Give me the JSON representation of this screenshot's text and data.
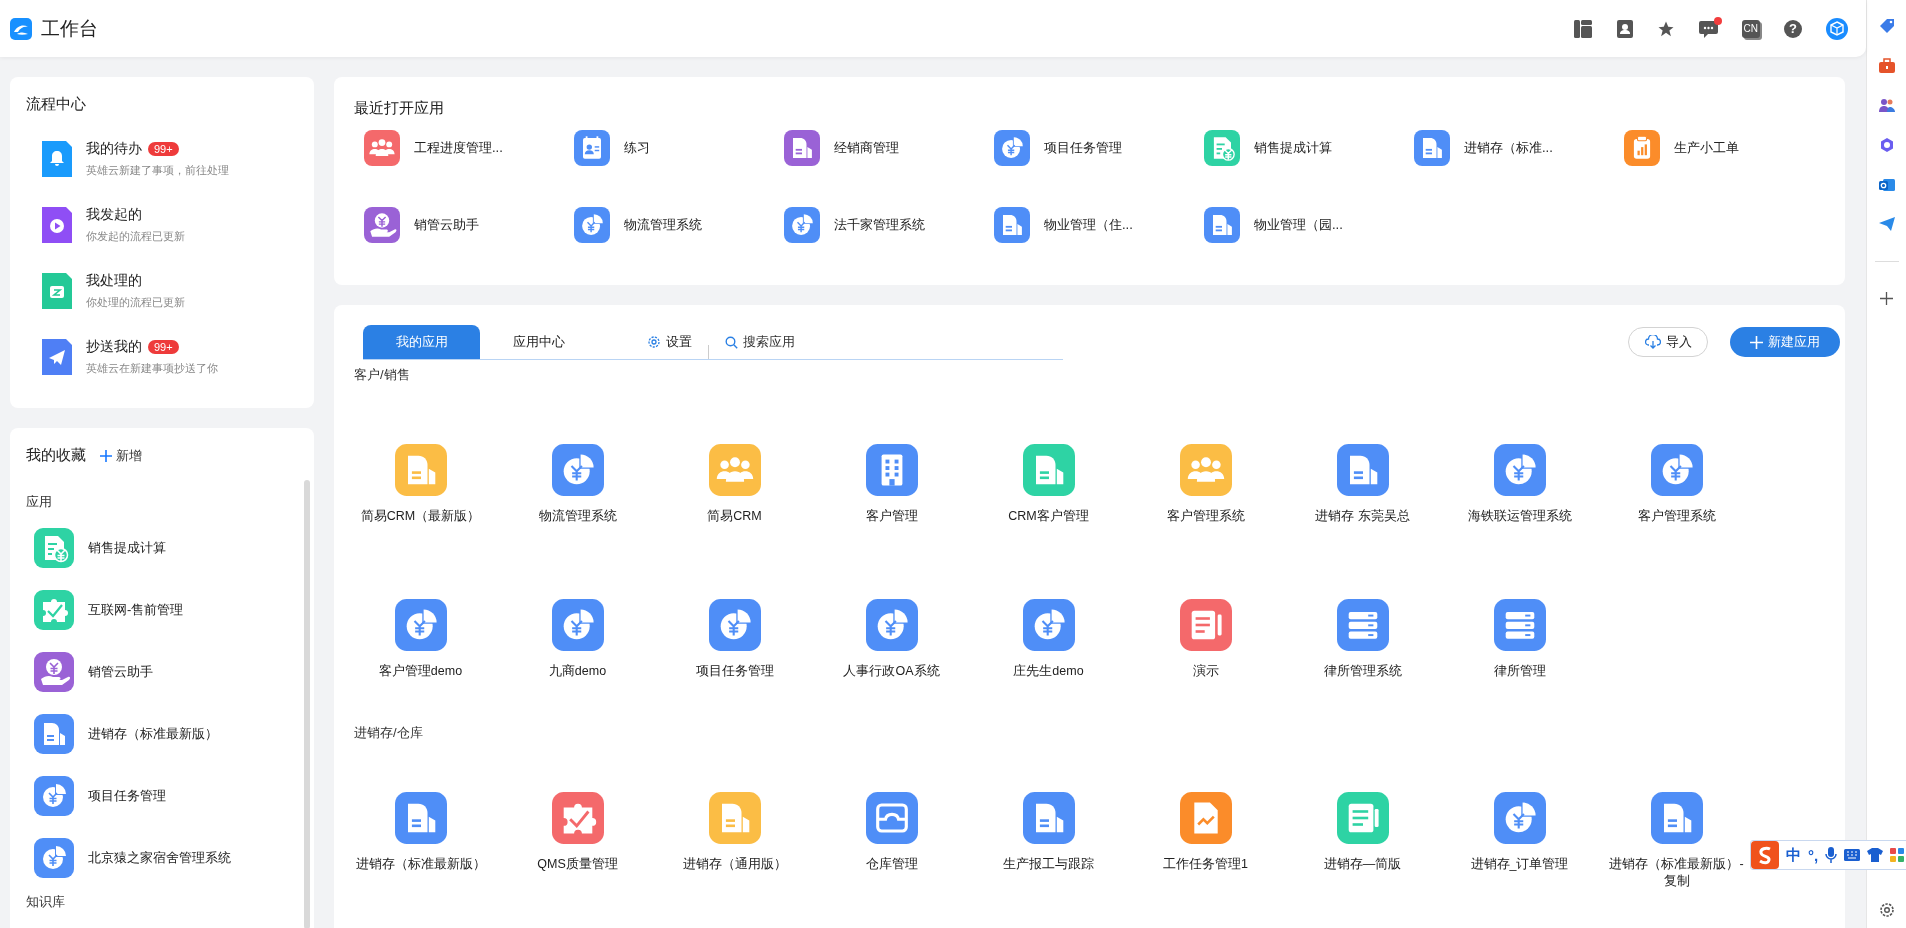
{
  "header": {
    "title": "工作台",
    "lang": "CN",
    "help": "?",
    "unread": true
  },
  "flow_center": {
    "title": "流程中心",
    "items": [
      {
        "kind": "bell",
        "color": "#1a9bfc",
        "title": "我的待办",
        "badge": "99+",
        "subtitle": "英雄云新建了事项，前往处理"
      },
      {
        "kind": "play",
        "color": "#8f4ef5",
        "title": "我发起的",
        "subtitle": "你发起的流程已更新"
      },
      {
        "kind": "box",
        "color": "#24c997",
        "title": "我处理的",
        "subtitle": "你处理的流程已更新"
      },
      {
        "kind": "plane",
        "color": "#4f7ff5",
        "title": "抄送我的",
        "badge": "99+",
        "subtitle": "英雄云在新建事项抄送了你"
      }
    ]
  },
  "favorites": {
    "title": "我的收藏",
    "add": "新增",
    "section": "应用",
    "next_section": "知识库",
    "items": [
      {
        "name": "销售提成计算",
        "kind": "docyen",
        "color": "#2ed3a4"
      },
      {
        "name": "互联网-售前管理",
        "kind": "puzzle",
        "color": "#2ed3a4"
      },
      {
        "name": "销管云助手",
        "kind": "hand",
        "color": "#9a62d6"
      },
      {
        "name": "进销存（标准最新版）",
        "kind": "doc",
        "color": "#4f8ef7"
      },
      {
        "name": "项目任务管理",
        "kind": "pie",
        "color": "#4f8ef7"
      },
      {
        "name": "北京猿之家宿舍管理系统",
        "kind": "pie",
        "color": "#4f8ef7"
      }
    ]
  },
  "recent": {
    "title": "最近打开应用",
    "items": [
      {
        "name": "工程进度管理...",
        "kind": "people",
        "color": "#f4696b"
      },
      {
        "name": "练习",
        "kind": "contact",
        "color": "#4f8ef7"
      },
      {
        "name": "经销商管理",
        "kind": "doc",
        "color": "#9a62d6"
      },
      {
        "name": "项目任务管理",
        "kind": "pie",
        "color": "#4f8ef7"
      },
      {
        "name": "销售提成计算",
        "kind": "docyen",
        "color": "#2ed3a4"
      },
      {
        "name": "进销存（标准...",
        "kind": "doc",
        "color": "#4f8ef7"
      },
      {
        "name": "生产小工单",
        "kind": "clipboard",
        "color": "#fb8c2a"
      },
      {
        "name": "销管云助手",
        "kind": "hand",
        "color": "#9a62d6"
      },
      {
        "name": "物流管理系统",
        "kind": "pie",
        "color": "#4f8ef7"
      },
      {
        "name": "法千家管理系统",
        "kind": "pie",
        "color": "#4f8ef7"
      },
      {
        "name": "物业管理（住...",
        "kind": "doc",
        "color": "#4f8ef7"
      },
      {
        "name": "物业管理（园...",
        "kind": "doc",
        "color": "#4f8ef7"
      }
    ]
  },
  "apps": {
    "tabs": [
      {
        "label": "我的应用",
        "selected": true
      },
      {
        "label": "应用中心",
        "selected": false
      }
    ],
    "settings": "设置",
    "search": {
      "placeholder": "搜索应用"
    },
    "import": "导入",
    "new": "新建应用",
    "groups": [
      {
        "title": "客户/销售",
        "items": [
          {
            "name": "简易CRM（最新版）",
            "kind": "doc",
            "color": "#fbbd45"
          },
          {
            "name": "物流管理系统",
            "kind": "pie",
            "color": "#4f8ef7"
          },
          {
            "name": "简易CRM",
            "kind": "people",
            "color": "#fbbd45"
          },
          {
            "name": "客户管理",
            "kind": "building",
            "color": "#4f8ef7"
          },
          {
            "name": "CRM客户管理",
            "kind": "doc",
            "color": "#2ed3a4"
          },
          {
            "name": "客户管理系统",
            "kind": "people",
            "color": "#fbbd45"
          },
          {
            "name": "进销存 东莞吴总",
            "kind": "doc",
            "color": "#4f8ef7"
          },
          {
            "name": "海铁联运管理系统",
            "kind": "pie",
            "color": "#4f8ef7"
          },
          {
            "name": "客户管理系统",
            "kind": "pie",
            "color": "#4f8ef7"
          },
          {
            "name": "客户管理demo",
            "kind": "pie",
            "color": "#4f8ef7"
          },
          {
            "name": "九商demo",
            "kind": "pie",
            "color": "#4f8ef7"
          },
          {
            "name": "项目任务管理",
            "kind": "pie",
            "color": "#4f8ef7"
          },
          {
            "name": "人事行政OA系统",
            "kind": "pie",
            "color": "#4f8ef7"
          },
          {
            "name": "庄先生demo",
            "kind": "pie",
            "color": "#4f8ef7"
          },
          {
            "name": "演示",
            "kind": "slides",
            "color": "#f4696b"
          },
          {
            "name": "律所管理系统",
            "kind": "server",
            "color": "#4f8ef7"
          },
          {
            "name": "律所管理",
            "kind": "server",
            "color": "#4f8ef7"
          }
        ]
      },
      {
        "title": "进销存/仓库",
        "items": [
          {
            "name": "进销存（标准最新版）",
            "kind": "doc",
            "color": "#4f8ef7"
          },
          {
            "name": "QMS质量管理",
            "kind": "puzzle",
            "color": "#f4696b"
          },
          {
            "name": "进销存（通用版）",
            "kind": "doc",
            "color": "#fbbd45"
          },
          {
            "name": "仓库管理",
            "kind": "warehouse",
            "color": "#4f8ef7"
          },
          {
            "name": "生产报工与跟踪",
            "kind": "doc",
            "color": "#4f8ef7"
          },
          {
            "name": "工作任务管理1",
            "kind": "docchart",
            "color": "#fb8c2a"
          },
          {
            "name": "进销存—简版",
            "kind": "lines",
            "color": "#2ed3a4"
          },
          {
            "name": "进销存_订单管理",
            "kind": "pie",
            "color": "#4f8ef7"
          },
          {
            "name": "进销存（标准最新版）-复制",
            "kind": "doc",
            "color": "#4f8ef7"
          }
        ]
      }
    ]
  },
  "ime": {
    "mode": "中",
    "punct": "°,"
  }
}
